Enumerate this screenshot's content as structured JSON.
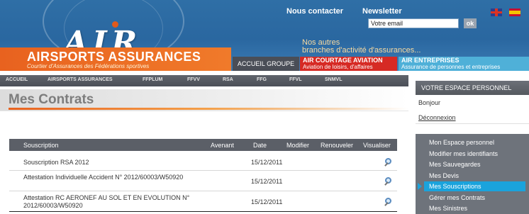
{
  "header": {
    "brand_name": "AIRSPORTS ASSURANCES",
    "brand_sub": "Courtier d'Assurances des Fédérations sportives",
    "logo_text": "AIR",
    "nous_contacter": "Nous contacter",
    "newsletter": "Newsletter",
    "email_value": "Votre email",
    "ok_label": "ok",
    "nos_autres_line1": "Nos autres",
    "nos_autres_line2": "branches d'activité d'assurances...",
    "accueil_groupe": "ACCUEIL GROUPE",
    "courtage_title": "AIR COURTAGE AVIATION",
    "courtage_sub": "Aviation de loisirs, d'affaires",
    "entreprises_title": "AIR ENTREPRISES",
    "entreprises_sub": "Assurance de personnes et entreprises"
  },
  "nav": {
    "items": [
      "ACCUEIL",
      "AIRSPORTS ASSURANCES",
      "FFPLUM",
      "FFVV",
      "RSA",
      "FFG",
      "FFVL",
      "SNMVL"
    ]
  },
  "main": {
    "title": "Mes Contrats",
    "columns": [
      "Souscription",
      "Avenant",
      "Date",
      "Modifier",
      "Renouveler",
      "Visualiser"
    ],
    "rows": [
      {
        "souscription": "Souscription RSA 2012",
        "date": "15/12/2011"
      },
      {
        "souscription": "Attestation Individuelle Accident N° 2012/60003/W50920",
        "date": "15/12/2011"
      },
      {
        "souscription": "Attestation RC AERONEF AU SOL ET EN EVOLUTION N° 2012/60003/W50920",
        "date": "15/12/2011"
      }
    ]
  },
  "sidebar": {
    "title": "VOTRE ESPACE PERSONNEL",
    "bonjour": "Bonjour",
    "deconnexion": "Déconnexion",
    "menu": [
      "Mon Espace personnel",
      "Modifier mes identifiants",
      "Mes Sauvegardes",
      "Mes Devis",
      "Mes Souscriptions",
      "Gérer mes Contrats",
      "Mes Sinistres"
    ],
    "active_item": "Mes Souscriptions"
  },
  "colors": {
    "brand_orange": "#e8621f",
    "header_blue": "#2f6fa6",
    "courtage_red": "#d62a24",
    "entreprises_blue": "#4fb0d8",
    "active_blue": "#1aa3dc"
  }
}
